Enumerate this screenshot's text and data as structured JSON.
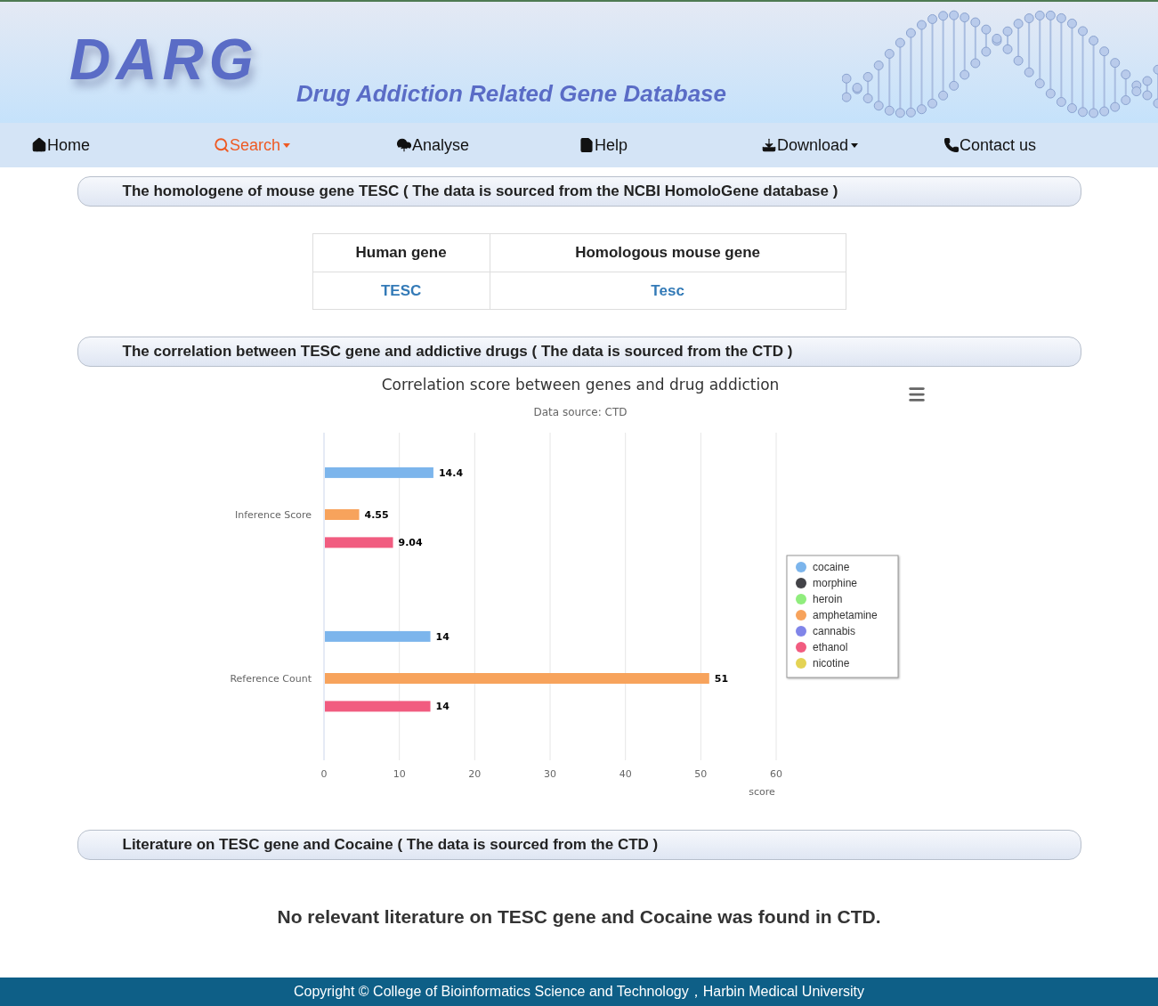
{
  "header": {
    "logo": "DARG",
    "subtitle": "Drug Addiction Related Gene Database"
  },
  "nav": [
    {
      "label": "Home",
      "selected": false,
      "dropdown": false
    },
    {
      "label": "Search",
      "selected": true,
      "dropdown": true
    },
    {
      "label": "Analyse",
      "selected": false,
      "dropdown": false
    },
    {
      "label": "Help",
      "selected": false,
      "dropdown": false
    },
    {
      "label": "Download",
      "selected": false,
      "dropdown": true
    },
    {
      "label": "Contact us",
      "selected": false,
      "dropdown": false
    }
  ],
  "sections": [
    {
      "kind": "table",
      "title": "The homologene of mouse gene TESC ( The data is sourced from the NCBI HomoloGene database )",
      "table": {
        "columns": [
          "Human gene",
          "Homologous mouse gene"
        ],
        "rows": [
          [
            "TESC",
            "Tesc"
          ]
        ]
      }
    },
    {
      "kind": "chart",
      "title": "The correlation between TESC gene and addictive drugs ( The data is sourced from the CTD )",
      "chart_data": {
        "type": "bar",
        "orientation": "horizontal",
        "title": "Correlation score between genes and drug addiction",
        "subtitle": "Data source: CTD",
        "xlabel": "score",
        "categories": [
          "Inference Score",
          "Reference Count"
        ],
        "series": [
          {
            "name": "cocaine",
            "color": "#7cb5ec",
            "values": [
              14.4,
              14
            ]
          },
          {
            "name": "morphine",
            "color": "#434348",
            "values": [
              null,
              null
            ]
          },
          {
            "name": "heroin",
            "color": "#90ed7d",
            "values": [
              null,
              null
            ]
          },
          {
            "name": "amphetamine",
            "color": "#f7a35c",
            "values": [
              4.55,
              51
            ]
          },
          {
            "name": "cannabis",
            "color": "#8085e9",
            "values": [
              null,
              null
            ]
          },
          {
            "name": "ethanol",
            "color": "#f15c80",
            "values": [
              9.04,
              14
            ]
          },
          {
            "name": "nicotine",
            "color": "#e4d354",
            "values": [
              null,
              null
            ]
          }
        ],
        "xlim": [
          0,
          60
        ],
        "xticks": [
          0,
          10,
          20,
          30,
          40,
          50,
          60
        ],
        "data_labels": true,
        "grid": true,
        "legend": true
      }
    },
    {
      "kind": "message",
      "title": "Literature on TESC gene and Cocaine ( The data is sourced from the CTD )",
      "message": "No relevant literature on TESC gene and Cocaine was found in CTD."
    }
  ],
  "footer": "Copyright © College of Bioinformatics Science and Technology，Harbin Medical University"
}
